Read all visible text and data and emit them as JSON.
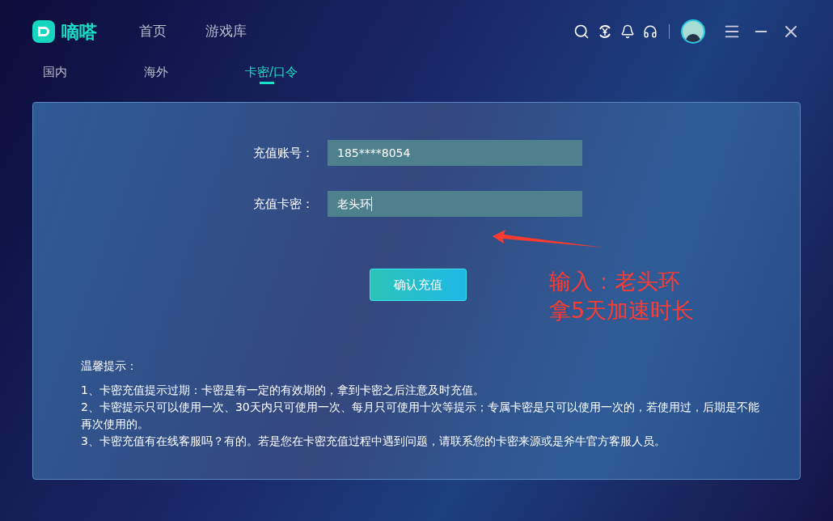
{
  "app": {
    "logo_text": "嘀嗒"
  },
  "nav": [
    {
      "label": "首页",
      "selected": false
    },
    {
      "label": "游戏库",
      "selected": false
    }
  ],
  "tabs": [
    {
      "label": "国内",
      "selected": false
    },
    {
      "label": "海外",
      "selected": false
    },
    {
      "label": "卡密/口令",
      "selected": true
    }
  ],
  "form": {
    "fields": [
      {
        "label": "充值账号：",
        "value": "185****8054"
      },
      {
        "label": "充值卡密：",
        "value": "老头环"
      }
    ],
    "submit": "确认充值"
  },
  "annotation": {
    "lines": [
      "输入：老头环",
      "拿5天加速时长"
    ]
  },
  "tips": {
    "title": "温馨提示：",
    "items": [
      "1、卡密充值提示过期：卡密是有一定的有效期的，拿到卡密之后注意及时充值。",
      "2、卡密提示只可以使用一次、30天内只可使用一次、每月只可使用十次等提示；专属卡密是只可以使用一次的，若使用过，后期是不能再次使用的。",
      "3、卡密充值有在线客服吗？有的。若是您在卡密充值过程中遇到问题，请联系您的卡密来源或是斧牛官方客服人员。"
    ]
  }
}
